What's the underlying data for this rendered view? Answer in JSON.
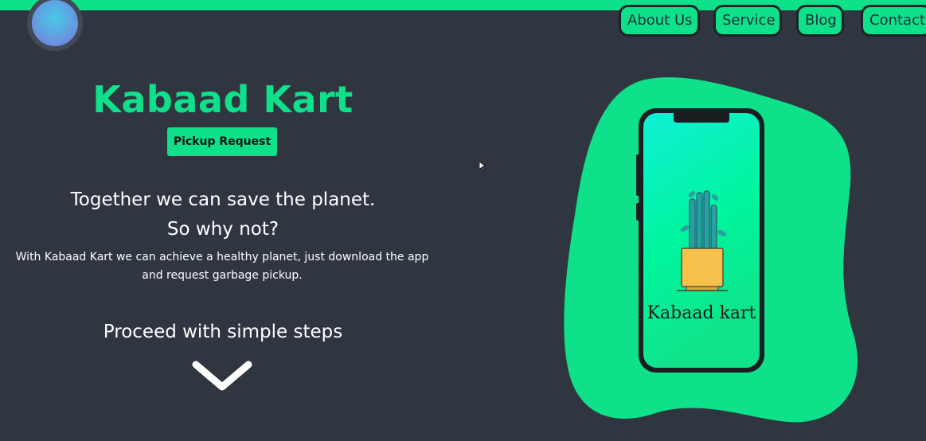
{
  "nav": {
    "items": [
      {
        "label": "About Us"
      },
      {
        "label": "Service"
      },
      {
        "label": "Blog"
      },
      {
        "label": "Contact"
      }
    ]
  },
  "hero": {
    "title": "Kabaad Kart",
    "pickup_button": "Pickup Request",
    "tagline_line1": "Together we can save the planet.",
    "tagline_line2": "So why not?",
    "description": "With Kabaad Kart we can achieve a healthy planet, just download the app and request garbage pickup.",
    "steps_heading": "Proceed with simple steps"
  },
  "phone": {
    "logo_text": "Kabaad kart"
  },
  "colors": {
    "accent": "#0fe08a",
    "background": "#2f3640"
  },
  "icons": {
    "logo": "circle-logo-icon",
    "scroll_down": "chevron-down-icon",
    "plant": "plant-pot-icon"
  }
}
